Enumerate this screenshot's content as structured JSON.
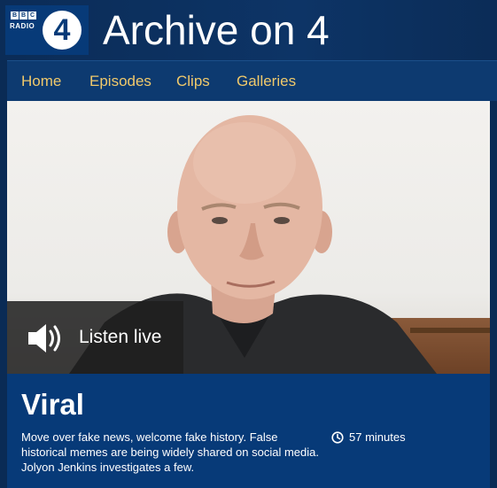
{
  "brand": {
    "bbc_letters": [
      "B",
      "B",
      "C"
    ],
    "radio_word": "RADIO",
    "station_number": "4",
    "logo_icon": "bbc-radio-4-logo"
  },
  "site": {
    "title": "Archive on 4"
  },
  "nav": {
    "items": [
      {
        "label": "Home"
      },
      {
        "label": "Episodes"
      },
      {
        "label": "Clips"
      },
      {
        "label": "Galleries"
      }
    ],
    "link_color": "#f0c96b"
  },
  "hero": {
    "image": "portrait-of-presenter",
    "listen_label": "Listen live",
    "listen_icon": "speaker-volume-icon"
  },
  "episode": {
    "title": "Viral",
    "description": "Move over fake news, welcome fake history. False historical memes are being widely shared on social media. Jolyon Jenkins investigates a few.",
    "duration": "57 minutes",
    "duration_icon": "clock-icon"
  },
  "colors": {
    "header_bg": "#0b2c57",
    "panel_bg": "#073a78",
    "accent": "#f0c96b"
  }
}
